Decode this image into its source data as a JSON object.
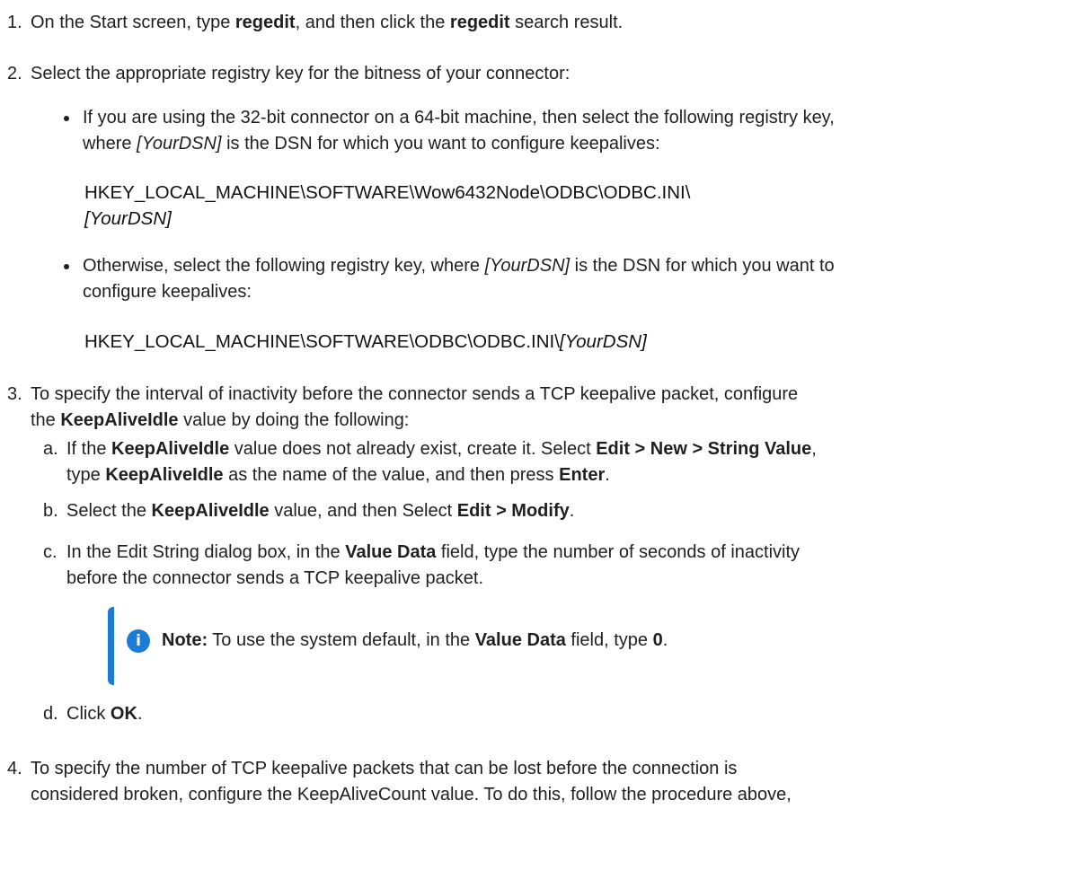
{
  "step1": {
    "num": "1.",
    "t1": "On the Start screen, type ",
    "b1": "regedit",
    "t2": ", and then click the ",
    "b2": "regedit",
    "t3": " search result."
  },
  "step2": {
    "num": "2.",
    "text": "Select the appropriate registry key for the bitness of your connector:",
    "bullet1": {
      "t1": "If you are using the 32-bit connector on a 64-bit machine, then select the following registry key,",
      "t2": "where ",
      "i1": "[YourDSN]",
      "t3": " is the DSN for which you want to configure keepalives:",
      "key_line1": "HKEY_LOCAL_MACHINE\\SOFTWARE\\Wow6432Node\\ODBC\\ODBC.INI\\",
      "key_line2": "[YourDSN]"
    },
    "bullet2": {
      "t1": "Otherwise, select the following registry key, where ",
      "i1": "[YourDSN]",
      "t2": " is the DSN for which you want to",
      "t3": "configure keepalives:",
      "key": "HKEY_LOCAL_MACHINE\\SOFTWARE\\ODBC\\ODBC.INI\\",
      "key_i": "[YourDSN]"
    }
  },
  "step3": {
    "num": "3.",
    "t1": "To specify the interval of inactivity before the connector sends a TCP keepalive packet, configure",
    "t2": "the ",
    "b1": "KeepAliveIdle",
    "t3": " value by doing the following:",
    "a": {
      "label": "a.",
      "t1": "If the ",
      "b1": "KeepAliveIdle",
      "t2": " value does not already exist, create it. Select ",
      "b2": "Edit > New > String Value",
      "t3": ",",
      "t4": "type ",
      "b3": "KeepAliveIdle",
      "t5": " as the name of the value, and then press ",
      "b4": "Enter",
      "t6": "."
    },
    "b": {
      "label": "b.",
      "t1": "Select the ",
      "b1": "KeepAliveIdle",
      "t2": " value, and then Select ",
      "b2": "Edit > Modify",
      "t3": "."
    },
    "c": {
      "label": "c.",
      "t1": "In the Edit String dialog box, in the ",
      "b1": "Value Data",
      "t2": " field, type the number of seconds of inactivity",
      "t3": "before the connector sends a TCP keepalive packet."
    },
    "note": {
      "label": "Note:",
      "t1": " To use the system default, in the ",
      "b1": "Value Data",
      "t2": " field, type ",
      "b2": "0",
      "t3": "."
    },
    "d": {
      "label": "d.",
      "t1": "Click ",
      "b1": "OK",
      "t2": "."
    }
  },
  "step4": {
    "num": "4.",
    "t1": "To specify the number of TCP keepalive packets that can be lost before the connection is",
    "t2": "considered broken, configure the KeepAliveCount value. To do this, follow the procedure above,"
  },
  "colors": {
    "text": "#1f1f1f",
    "accent": "#1c7bd4"
  },
  "icons": {
    "note": "info-icon"
  }
}
